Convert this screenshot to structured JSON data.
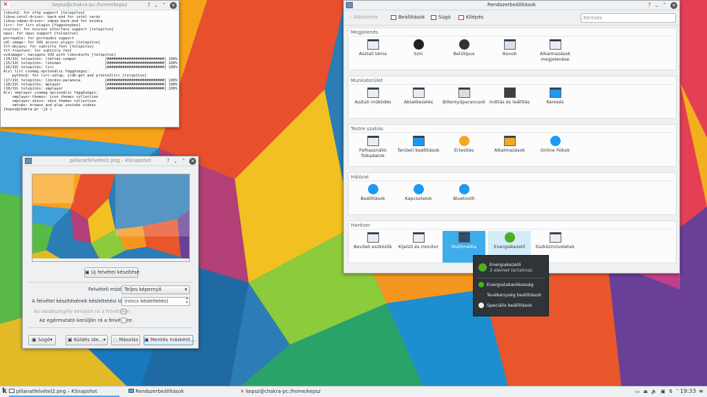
{
  "terminal": {
    "title": "kepsz@chakra-pc:/home/kepsz",
    "lines": [
      "libssh2: for sftp support [telepítve]",
      "libva-intel-driver: back-end for intel cards",
      "libva-vdpau-driver: vdpau back-end for nvidia",
      "lirc: for lirc plugin [függvényben]",
      "ncurses: for ncurses interface support [telepítve]",
      "opus: for opus support [telepítve]",
      "portaudio: for portaudio support",
      "sdl-image: for SVG access plugin [telepítve]",
      "ttf-dejavu: for subtitle font [telepítve]",
      "ttf-freefont: for subtitle font",
      "vcdimager: navigate VCD with libvcdinfo [telepítve]",
      "(14/19) telepítés: libfidi-compat             [##########################] 100%",
      "(15/19) telepítés: libiman                    [##########################] 100%",
      "(16/19) telepítés: lirc                       [##########################] 100%",
      "A(z) lirc csomag opcionális függőségei:",
      "    python2: for lirc-setup, irdb-get and pronto2lirc [telepítve]",
      "(17/19) telepítés: libcdio-paranoia           [##########################] 100%",
      "(18/19) telepítés: mplayer                    [##########################] 100%",
      "(19/19) telepítés: smplayer                   [##########################] 100%",
      "A(z) smplayer csomag opcionális függőségei:",
      "    smplayer-themes: icon themes collection",
      "    smplayer-skins: skin themes collection",
      "    smtube: browse and play youtube videos",
      "[kepsz@chakra-pc ~]$ ▯"
    ]
  },
  "ksnapshot": {
    "title": "pillanatfelvétel2.png – KSnapshot",
    "new_btn": "Új felvétel készítése",
    "mode_label": "Felvételi mód:",
    "mode_value": "Teljes képernyő",
    "delay_label": "A felvétel készítésének késleltetési ideje:",
    "delay_value": "(nincs késleltetés)",
    "border_label": "Az ablakszegély kerüljön rá a felvételre:",
    "cursor_label": "Az egérmutató kerüljön rá a felvételre:",
    "help_btn": "Súgó",
    "send_btn": "Küldés ide...",
    "copy_btn": "Másolás",
    "save_btn": "Mentés másként..."
  },
  "settings": {
    "title": "Rendszerbeállítások",
    "toolbar": {
      "overview": "Áttekintés",
      "config": "Beállítások",
      "help": "Súgó",
      "quit": "Kilépés"
    },
    "search_placeholder": "Keresés",
    "groups": [
      {
        "name": "Megjelenés",
        "items": [
          {
            "label": "Asztali téma",
            "icon": "desktop-theme-icon"
          },
          {
            "label": "Szín",
            "icon": "color-icon"
          },
          {
            "label": "Betűtípus",
            "icon": "font-icon"
          },
          {
            "label": "Ikonok",
            "icon": "icons-icon"
          },
          {
            "label": "Alkalmazások megjelenése",
            "icon": "app-style-icon"
          }
        ]
      },
      {
        "name": "Munkaterület",
        "items": [
          {
            "label": "Asztali működés",
            "icon": "desktop-behavior-icon"
          },
          {
            "label": "Ablakkezelés",
            "icon": "window-management-icon"
          },
          {
            "label": "Billentyűparancsok",
            "icon": "shortcuts-icon"
          },
          {
            "label": "Indítás és leállítás",
            "icon": "startup-icon"
          },
          {
            "label": "Keresés",
            "icon": "search-icon"
          }
        ]
      },
      {
        "name": "Testre szabás",
        "items": [
          {
            "label": "Felhasználói fiókadatok",
            "icon": "account-icon"
          },
          {
            "label": "Területi beállítások",
            "icon": "locale-icon"
          },
          {
            "label": "Értesítés",
            "icon": "notification-icon"
          },
          {
            "label": "Alkalmazások",
            "icon": "applications-icon"
          },
          {
            "label": "Online fiókok",
            "icon": "online-accounts-icon"
          }
        ]
      },
      {
        "name": "Hálózat",
        "items": [
          {
            "label": "Beállítások",
            "icon": "network-settings-icon"
          },
          {
            "label": "Kapcsolatok",
            "icon": "connections-icon"
          },
          {
            "label": "Bluetooth",
            "icon": "bluetooth-icon"
          }
        ]
      },
      {
        "name": "Hardver",
        "items": [
          {
            "label": "Beviteli eszközök",
            "icon": "input-devices-icon"
          },
          {
            "label": "Kijelző és monitor",
            "icon": "display-icon"
          },
          {
            "label": "Multimédia",
            "icon": "multimedia-icon"
          },
          {
            "label": "Energiakezelő",
            "icon": "energy-icon"
          },
          {
            "label": "Eszközműveletek",
            "icon": "device-actions-icon"
          }
        ]
      }
    ]
  },
  "popup": {
    "title": "Energiakezelő",
    "subtitle": "3 elemet tartalmaz",
    "items": [
      "Energiatakarékosság",
      "Tevékenység beállítások",
      "Speciális beállítások"
    ]
  },
  "taskbar": {
    "tasks": [
      "pillanatfelvétel2.png – KSnapshot",
      "Rendszerbeállítások",
      "kepsz@chakra-pc:/home/kepsz"
    ],
    "clock": "19:33"
  },
  "colors": {
    "accent": "#3daee9",
    "energy": "#4caf20"
  }
}
